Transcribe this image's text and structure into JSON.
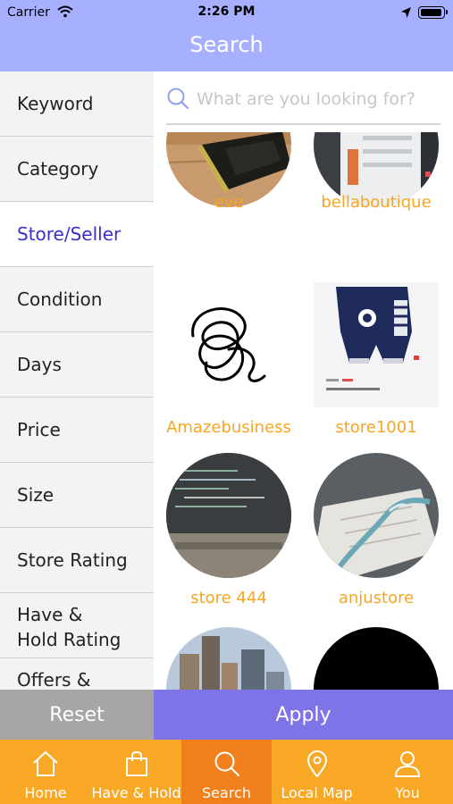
{
  "status_bar": {
    "carrier": "Carrier",
    "time": "2:26 PM",
    "icons": [
      "wifi-icon",
      "location-arrow-icon",
      "battery-icon"
    ]
  },
  "nav": {
    "title": "Search"
  },
  "filters": [
    {
      "label": "Keyword",
      "active": false
    },
    {
      "label": "Category",
      "active": false
    },
    {
      "label": "Store/Seller",
      "active": true
    },
    {
      "label": "Condition",
      "active": false
    },
    {
      "label": "Days",
      "active": false
    },
    {
      "label": "Price",
      "active": false
    },
    {
      "label": "Size",
      "active": false
    },
    {
      "label": "Store Rating",
      "active": false
    },
    {
      "label_line1": "Have &",
      "label_line2": "Hold Rating",
      "active": false
    },
    {
      "label_line1": "Offers &",
      "active": false
    }
  ],
  "search": {
    "placeholder": "What are you looking for?",
    "value": ""
  },
  "stores": [
    {
      "name": "eve"
    },
    {
      "name": "bellaboutique"
    },
    {
      "name": "Amazebusiness"
    },
    {
      "name": "store1001"
    },
    {
      "name": "store 444"
    },
    {
      "name": "anjustore"
    },
    {
      "name": ""
    },
    {
      "name": ""
    }
  ],
  "actions": {
    "reset": "Reset",
    "apply": "Apply"
  },
  "tabs": [
    {
      "label": "Home",
      "icon": "home-icon",
      "active": false
    },
    {
      "label": "Have & Hold",
      "icon": "shopping-bag-icon",
      "active": false
    },
    {
      "label": "Search",
      "icon": "search-icon",
      "active": true
    },
    {
      "label": "Local Map",
      "icon": "map-pin-icon",
      "active": false
    },
    {
      "label": "You",
      "icon": "user-icon",
      "active": false
    }
  ],
  "colors": {
    "header": "#a7b0ff",
    "accent_text": "#3a30c8",
    "store_name": "#f6a623",
    "reset": "#a6a6a6",
    "apply": "#7f73e8",
    "tab_bar": "#f9a825",
    "tab_active": "#f07f1c"
  }
}
